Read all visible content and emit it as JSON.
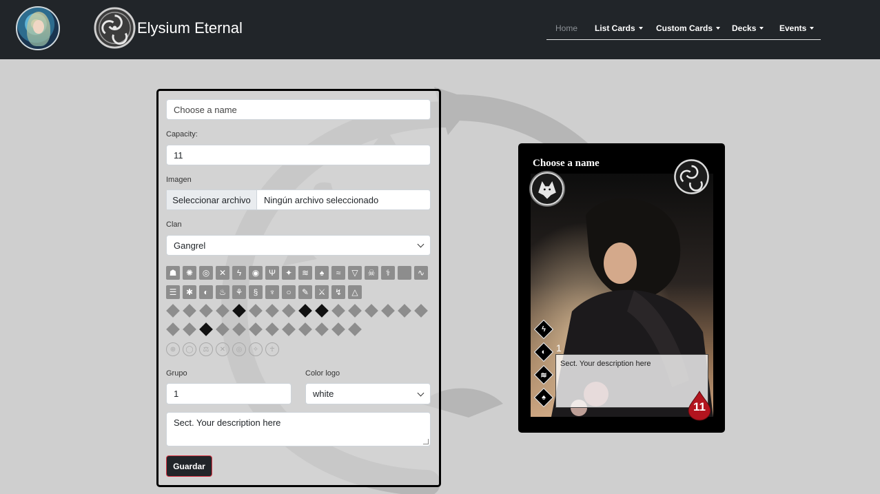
{
  "header": {
    "brand_name": "Elysium Eternal",
    "nav": [
      {
        "label": "Home",
        "dropdown": false,
        "active": false
      },
      {
        "label": "List Cards",
        "dropdown": true
      },
      {
        "label": "Custom Cards",
        "dropdown": true
      },
      {
        "label": "Decks",
        "dropdown": true
      },
      {
        "label": "Events",
        "dropdown": true
      }
    ]
  },
  "form": {
    "name_placeholder": "Choose a name",
    "capacity_label": "Capacity:",
    "capacity_value": "11",
    "image_label": "Imagen",
    "file_button": "Seleccionar archivo",
    "file_status": "Ningún archivo seleccionado",
    "clan_label": "Clan",
    "clan_value": "Gangrel",
    "group_label": "Grupo",
    "group_value": "1",
    "color_label": "Color logo",
    "color_value": "white",
    "description_value": "Sect. Your description here",
    "save_label": "Guardar"
  },
  "icons": {
    "row1": [
      "animalism",
      "auspex",
      "celerity",
      "chimerstry",
      "potence",
      "dominate",
      "dementation",
      "fortitude",
      "obtenebration",
      "protean",
      "presence",
      "thaumaturgy",
      "necromancy",
      "quietus",
      "blank",
      "serpentis"
    ],
    "row2": [
      "obfuscate",
      "vicissitude",
      "obeah",
      "melpominee",
      "mytherceria",
      "daimoinon",
      "sanguinus",
      "temporis",
      "valeren",
      "spiritus",
      "striga"
    ],
    "row3": [
      "animalism-sup",
      "auspex-sup",
      "celerity-sup",
      "chimerstry-sup",
      "potence-sup",
      "dominate-sup",
      "dementation-sup",
      "fortitude-sup",
      "obtenebration-sup",
      "protean-sup",
      "presence-sup",
      "thaumaturgy-sup",
      "necromancy-sup",
      "quietus-sup",
      "blank-sup",
      "serpentis-sup"
    ],
    "row4": [
      "obfuscate-sup",
      "vicissitude-sup",
      "obeah-sup",
      "melpominee-sup",
      "mytherceria-sup",
      "daimoinon-sup",
      "sanguinus-sup",
      "temporis-sup",
      "valeren-sup",
      "spiritus-sup",
      "striga-sup",
      "thanatosis-sup"
    ],
    "row5": [
      "defense",
      "innocence",
      "justice",
      "martyrdom",
      "redemption",
      "vengeance",
      "vision"
    ]
  },
  "card": {
    "title": "Choose a name",
    "group": "1",
    "description": "Sect. Your description here",
    "capacity": "11"
  },
  "colors": {
    "navbar": "#212529",
    "background": "#cfcfcf",
    "save_border": "#dc3545",
    "blood": "#b3141e"
  }
}
